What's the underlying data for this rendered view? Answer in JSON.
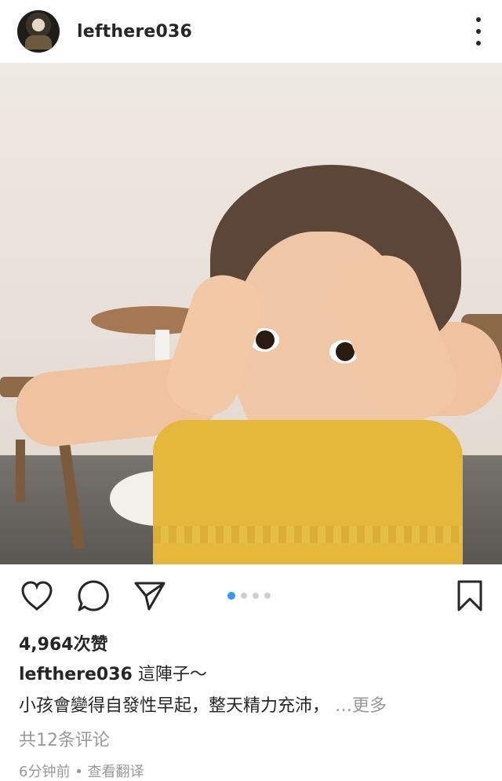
{
  "header": {
    "username": "lefthere036",
    "avatar_icon": "user-avatar-icon",
    "more_icon": "more-vertical-icon"
  },
  "post": {
    "image_icon": "photo-image",
    "carousel": {
      "total": 4,
      "active_index": 0,
      "active_color": "#3897f0"
    }
  },
  "actions": {
    "like_icon": "heart-icon",
    "comment_icon": "comment-icon",
    "share_icon": "send-icon",
    "save_icon": "bookmark-icon"
  },
  "stats": {
    "likes": "4,964次赞"
  },
  "caption": {
    "user": "lefthere036",
    "line1": "這陣子～",
    "line2": "小孩會變得自發性早起，整天精力充沛，",
    "more": "…更多"
  },
  "comments": {
    "summary": "共12条评论"
  },
  "footer": {
    "time": "6分钟前",
    "separator": "•",
    "translate": "查看翻译"
  }
}
